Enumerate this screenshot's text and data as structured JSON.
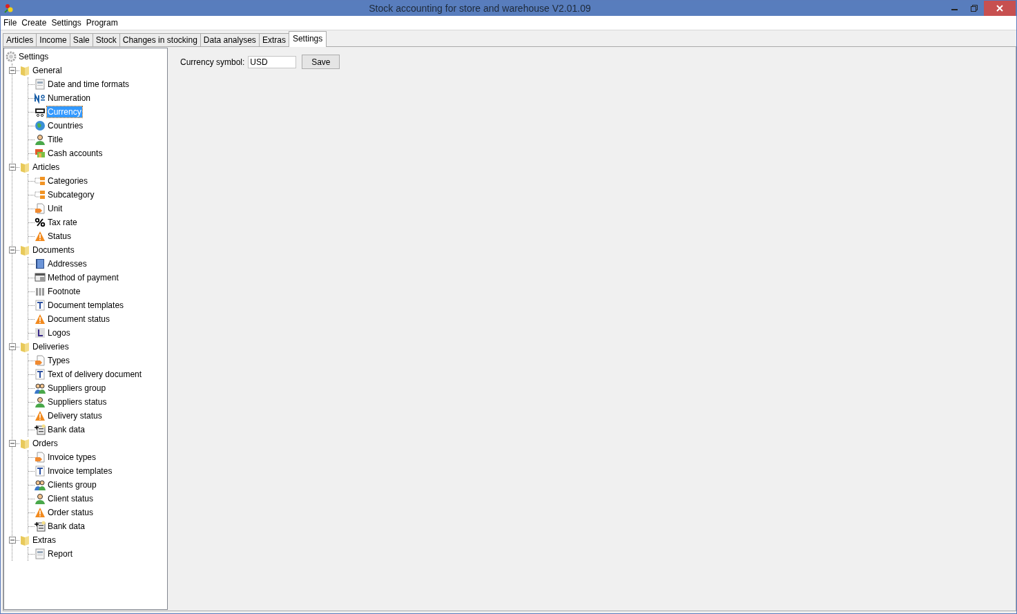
{
  "window": {
    "title": "Stock accounting for store and warehouse V2.01.09"
  },
  "menu": [
    "File",
    "Create",
    "Settings",
    "Program"
  ],
  "tabs": [
    {
      "label": "Articles",
      "selected": false
    },
    {
      "label": "Income",
      "selected": false
    },
    {
      "label": "Sale",
      "selected": false
    },
    {
      "label": "Stock",
      "selected": false
    },
    {
      "label": "Changes in stocking",
      "selected": false
    },
    {
      "label": "Data analyses",
      "selected": false
    },
    {
      "label": "Extras",
      "selected": false
    },
    {
      "label": "Settings",
      "selected": true
    }
  ],
  "tree": {
    "label": "Settings",
    "children": [
      {
        "label": "General",
        "expanded": true,
        "children": [
          {
            "label": "Date and time formats",
            "kind": "doc",
            "selected": false
          },
          {
            "label": "Numeration",
            "kind": "number",
            "selected": false
          },
          {
            "label": "Currency",
            "kind": "currency",
            "selected": true
          },
          {
            "label": "Countries",
            "kind": "globe",
            "selected": false
          },
          {
            "label": "Title",
            "kind": "person",
            "selected": false
          },
          {
            "label": "Cash accounts",
            "kind": "cash",
            "selected": false
          }
        ]
      },
      {
        "label": "Articles",
        "expanded": true,
        "children": [
          {
            "label": "Categories",
            "kind": "folders",
            "selected": false
          },
          {
            "label": "Subcategory",
            "kind": "folders",
            "selected": false
          },
          {
            "label": "Unit",
            "kind": "tag",
            "selected": false
          },
          {
            "label": "Tax rate",
            "kind": "percent",
            "selected": false
          },
          {
            "label": "Status",
            "kind": "warning",
            "selected": false
          }
        ]
      },
      {
        "label": "Documents",
        "expanded": true,
        "children": [
          {
            "label": "Addresses",
            "kind": "book",
            "selected": false
          },
          {
            "label": "Method of payment",
            "kind": "payment",
            "selected": false
          },
          {
            "label": "Footnote",
            "kind": "columns",
            "selected": false
          },
          {
            "label": "Document templates",
            "kind": "text",
            "selected": false
          },
          {
            "label": "Document status",
            "kind": "warning",
            "selected": false
          },
          {
            "label": "Logos",
            "kind": "logo",
            "selected": false
          }
        ]
      },
      {
        "label": "Deliveries",
        "expanded": true,
        "children": [
          {
            "label": "Types",
            "kind": "tag",
            "selected": false
          },
          {
            "label": "Text of delivery document",
            "kind": "text",
            "selected": false
          },
          {
            "label": "Suppliers group",
            "kind": "group",
            "selected": false
          },
          {
            "label": "Suppliers status",
            "kind": "person",
            "selected": false
          },
          {
            "label": "Delivery status",
            "kind": "warning",
            "selected": false
          },
          {
            "label": "Bank data",
            "kind": "bank",
            "selected": false
          }
        ]
      },
      {
        "label": "Orders",
        "expanded": true,
        "children": [
          {
            "label": "Invoice types",
            "kind": "tag",
            "selected": false
          },
          {
            "label": "Invoice templates",
            "kind": "text",
            "selected": false
          },
          {
            "label": "Clients group",
            "kind": "group",
            "selected": false
          },
          {
            "label": "Client status",
            "kind": "person",
            "selected": false
          },
          {
            "label": "Order status",
            "kind": "warning",
            "selected": false
          },
          {
            "label": "Bank data",
            "kind": "bank",
            "selected": false
          }
        ]
      },
      {
        "label": "Extras",
        "expanded": true,
        "children": [
          {
            "label": "Report",
            "kind": "doc",
            "selected": false
          }
        ]
      }
    ]
  },
  "form": {
    "label": "Currency symbol:",
    "value": "USD",
    "button": "Save"
  }
}
